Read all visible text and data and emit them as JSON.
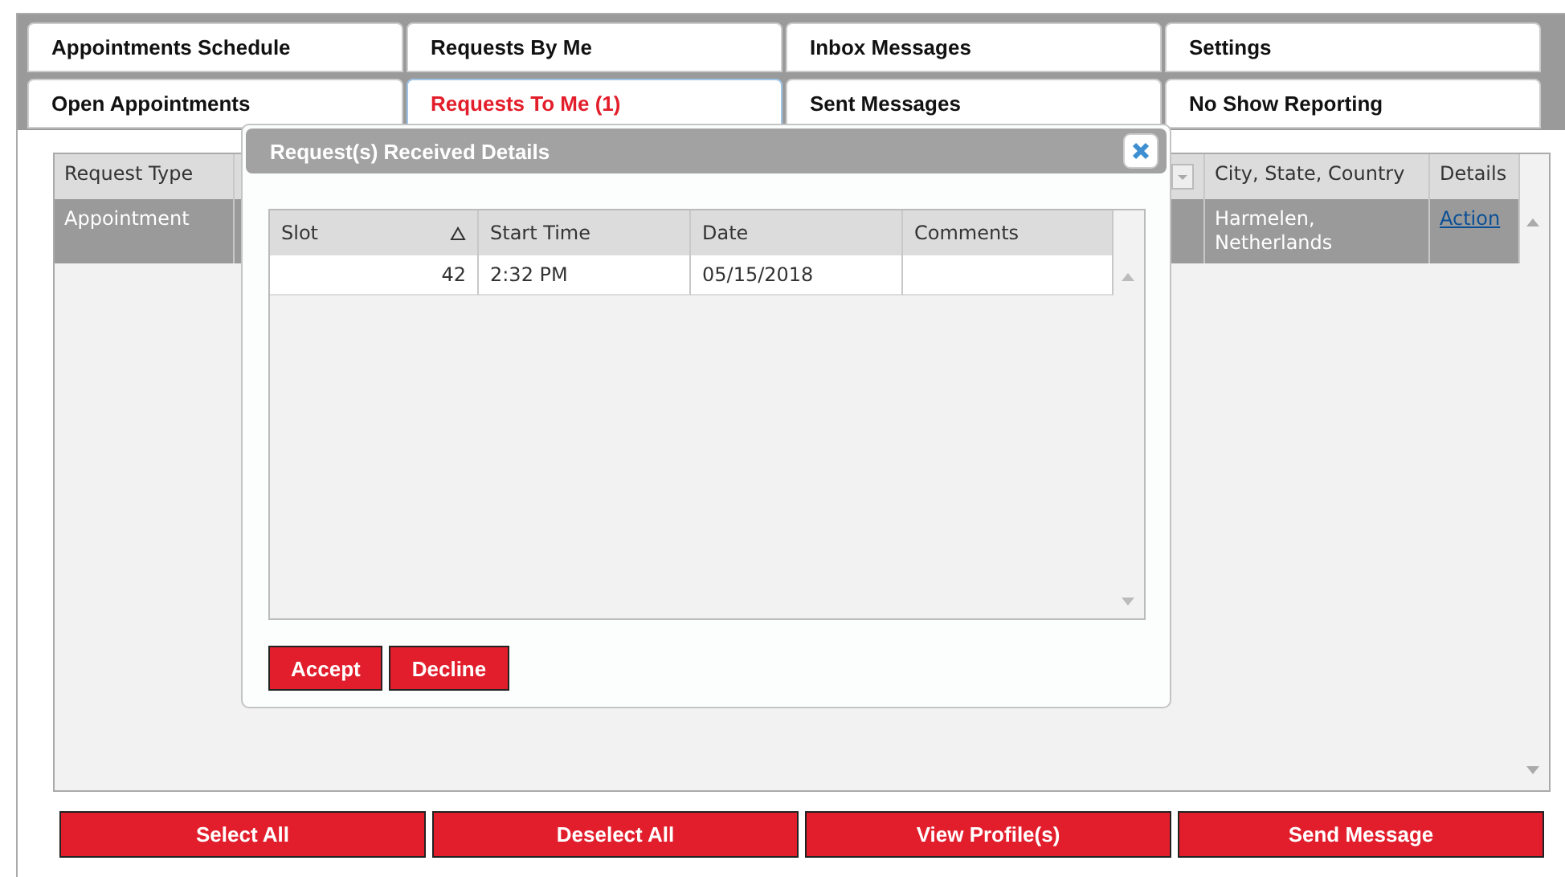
{
  "tabs": [
    {
      "label": "Appointments Schedule",
      "selected": false
    },
    {
      "label": "Requests By Me",
      "selected": false
    },
    {
      "label": "Inbox Messages",
      "selected": false
    },
    {
      "label": "Settings",
      "selected": false
    },
    {
      "label": "Open Appointments",
      "selected": false
    },
    {
      "label": "Requests To Me (1)",
      "selected": true
    },
    {
      "label": "Sent Messages",
      "selected": false
    },
    {
      "label": "No Show Reporting",
      "selected": false
    }
  ],
  "grid": {
    "columns": [
      "Request Type",
      "City, State, Country",
      "Details"
    ],
    "rows": [
      {
        "request_type": "Appointment",
        "location": "Harmelen, Netherlands",
        "details_link": "Action",
        "selected": true
      }
    ]
  },
  "dialog": {
    "title": "Request(s) Received Details",
    "columns": [
      {
        "label": "Slot",
        "sorted": true
      },
      {
        "label": "Start Time"
      },
      {
        "label": "Date"
      },
      {
        "label": "Comments"
      }
    ],
    "rows": [
      {
        "slot": "42",
        "start_time": "2:32 PM",
        "date": "05/15/2018"
      }
    ],
    "buttons": [
      "Accept",
      "Decline"
    ]
  },
  "footer_buttons": [
    "Select All",
    "Deselect All",
    "View Profile(s)",
    "Send Message"
  ]
}
